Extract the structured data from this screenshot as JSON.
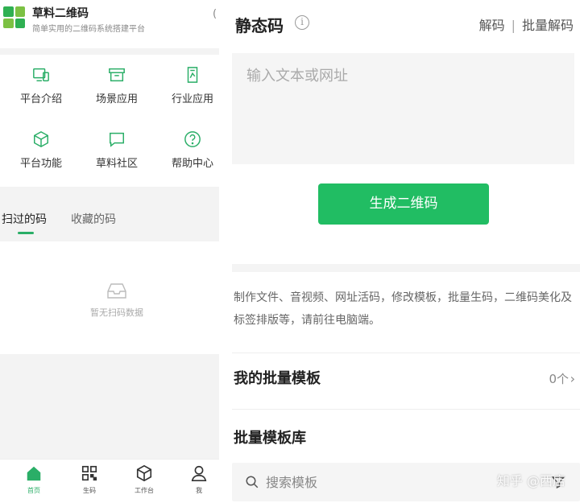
{
  "left": {
    "brand": {
      "title": "草料二维码",
      "subtitle": "简单实用的二维码系统搭建平台",
      "more": "(",
      "logo_colors": [
        "#2fb052",
        "#7cc143"
      ]
    },
    "grid": [
      {
        "label": "平台介绍",
        "icon": "device-icon"
      },
      {
        "label": "场景应用",
        "icon": "box-icon"
      },
      {
        "label": "行业应用",
        "icon": "document-icon"
      },
      {
        "label": "平台功能",
        "icon": "cube-icon"
      },
      {
        "label": "草料社区",
        "icon": "chat-icon"
      },
      {
        "label": "帮助中心",
        "icon": "question-icon"
      }
    ],
    "tabs": [
      {
        "label": "扫过的码",
        "active": true
      },
      {
        "label": "收藏的码",
        "active": false
      }
    ],
    "empty_text": "暂无扫码数据",
    "tabbar": [
      {
        "label": "首页",
        "icon": "home-icon",
        "active": true
      },
      {
        "label": "生码",
        "icon": "qrcode-icon",
        "active": false
      },
      {
        "label": "工作台",
        "icon": "workbench-icon",
        "active": false
      },
      {
        "label": "我",
        "icon": "user-icon",
        "active": false
      }
    ]
  },
  "right": {
    "title": "静态码",
    "info_icon": "i",
    "links": {
      "decode": "解码",
      "batch_decode": "批量解码",
      "separator": "|"
    },
    "input_placeholder": "输入文本或网址",
    "generate_label": "生成二维码",
    "description": "制作文件、音视频、网址活码，修改模板，批量生码，二维码美化及标签排版等，请前往电脑端。",
    "my_batch": {
      "label": "我的批量模板",
      "count": "0个",
      "chevron": "›"
    },
    "batch_library": "批量模板库",
    "search_placeholder": "搜索模板",
    "watermark": "知乎 @西店"
  },
  "colors": {
    "accent": "#2aae67",
    "button": "#21bd63"
  }
}
